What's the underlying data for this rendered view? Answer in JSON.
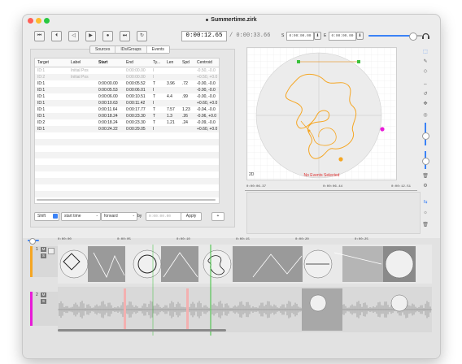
{
  "window": {
    "title": "Summertime.zirk",
    "close_color": "#ff5f57",
    "min_color": "#febc2e",
    "max_color": "#28c840"
  },
  "toolbar": {
    "icons": [
      "skip-to-start-icon",
      "step-back-icon",
      "play-reverse-icon",
      "play-icon",
      "stop-icon",
      "skip-to-end-icon",
      "loop-icon"
    ],
    "current_time": "0:00:12.65",
    "total_time": "/ 0:00:33.66",
    "s_label": "S",
    "s_value": "0:00:00.00",
    "e_label": "E",
    "e_value": "0:00:00.00",
    "volume": 0.8
  },
  "tabs": [
    {
      "label": "Sources"
    },
    {
      "label": "IDs/Groups"
    },
    {
      "label": "Events",
      "active": true
    }
  ],
  "table": {
    "columns": [
      "Target",
      "Label",
      "Start",
      "End",
      "Ty...",
      "Len",
      "Spd",
      "Centroid"
    ],
    "rows": [
      {
        "target": "ID:1",
        "label": "Initial Pos",
        "start": "",
        "end": "0:00:00.00",
        "type": "I",
        "len": "",
        "spd": "",
        "centroid": "-0.50, -0.0",
        "dim": true
      },
      {
        "target": "ID:2",
        "label": "Initial Pos",
        "start": "",
        "end": "0:00:00.00",
        "type": "I",
        "len": "",
        "spd": "",
        "centroid": "+0.50, +0.0",
        "dim": true
      },
      {
        "target": "ID:1",
        "label": "",
        "start": "0:00:00.00",
        "end": "0:00:05.52",
        "type": "T",
        "len": "3.96",
        "spd": ".72",
        "centroid": "-0.00, -0.0"
      },
      {
        "target": "ID:1",
        "label": "",
        "start": "0:00:05.53",
        "end": "0:00:06.01",
        "type": "I",
        "len": "",
        "spd": "",
        "centroid": "-0.00, -0.0"
      },
      {
        "target": "ID:1",
        "label": "",
        "start": "0:00:06.00",
        "end": "0:00:10.51",
        "type": "T",
        "len": "4.4",
        "spd": ".99",
        "centroid": "-0.00, -0.0"
      },
      {
        "target": "ID:1",
        "label": "",
        "start": "0:00:10.63",
        "end": "0:00:11.42",
        "type": "I",
        "len": "",
        "spd": "",
        "centroid": "+0.60, +0.0"
      },
      {
        "target": "ID:1",
        "label": "",
        "start": "0:00:11.64",
        "end": "0:00:17.77",
        "type": "T",
        "len": "7.57",
        "spd": "1.23",
        "centroid": "-0.04, -0.0"
      },
      {
        "target": "ID:1",
        "label": "",
        "start": "0:00:18.24",
        "end": "0:00:23.30",
        "type": "T",
        "len": "1.3",
        "spd": ".26",
        "centroid": "-0.06, +0.0"
      },
      {
        "target": "ID:2",
        "label": "",
        "start": "0:00:18.24",
        "end": "0:00:23.30",
        "type": "T",
        "len": "1.21",
        "spd": ".24",
        "centroid": "-0.09, -0.0"
      },
      {
        "target": "ID:1",
        "label": "",
        "start": "0:00:24.22",
        "end": "0:00:29.05",
        "type": "I",
        "len": "",
        "spd": "",
        "centroid": "+0.60, +0.0"
      }
    ]
  },
  "controls": {
    "shift_label": "Shift",
    "field1": "start time",
    "field2": "forward",
    "by_label": "by",
    "by_value": "0:00:00.00",
    "apply_label": "Apply",
    "add_label": "+"
  },
  "viewport": {
    "mode_label": "2D",
    "status": "No Events Selected",
    "path_color": "#f5a623",
    "marker1_color": "#e81bd8",
    "marker2_color": "#f5a623",
    "anchor_color": "#3cc13b",
    "ruler": [
      "0:00:06.37",
      "0:00:06.44",
      "0:00:12.51"
    ]
  },
  "timeline": {
    "ruler": [
      "0:00:00",
      "0:00:05",
      "0:00:10",
      "0:00:15",
      "0:00:20",
      "0:00:25"
    ],
    "track1": {
      "number": "1",
      "m_label": "M",
      "s_label": "S",
      "color": "#f5a623"
    },
    "track2": {
      "number": "2",
      "m_label": "M",
      "s_label": "S",
      "color": "#e81bd8"
    },
    "playhead_color": "#3cc13b"
  },
  "sidebar_icons": [
    "select-icon",
    "pen-icon",
    "eraser-icon",
    "scale-icon",
    "rotate-icon",
    "move-icon",
    "lock-icon",
    "slider-icon",
    "trash-icon",
    "view-icon",
    "sun-icon",
    "trash-icon-2"
  ]
}
